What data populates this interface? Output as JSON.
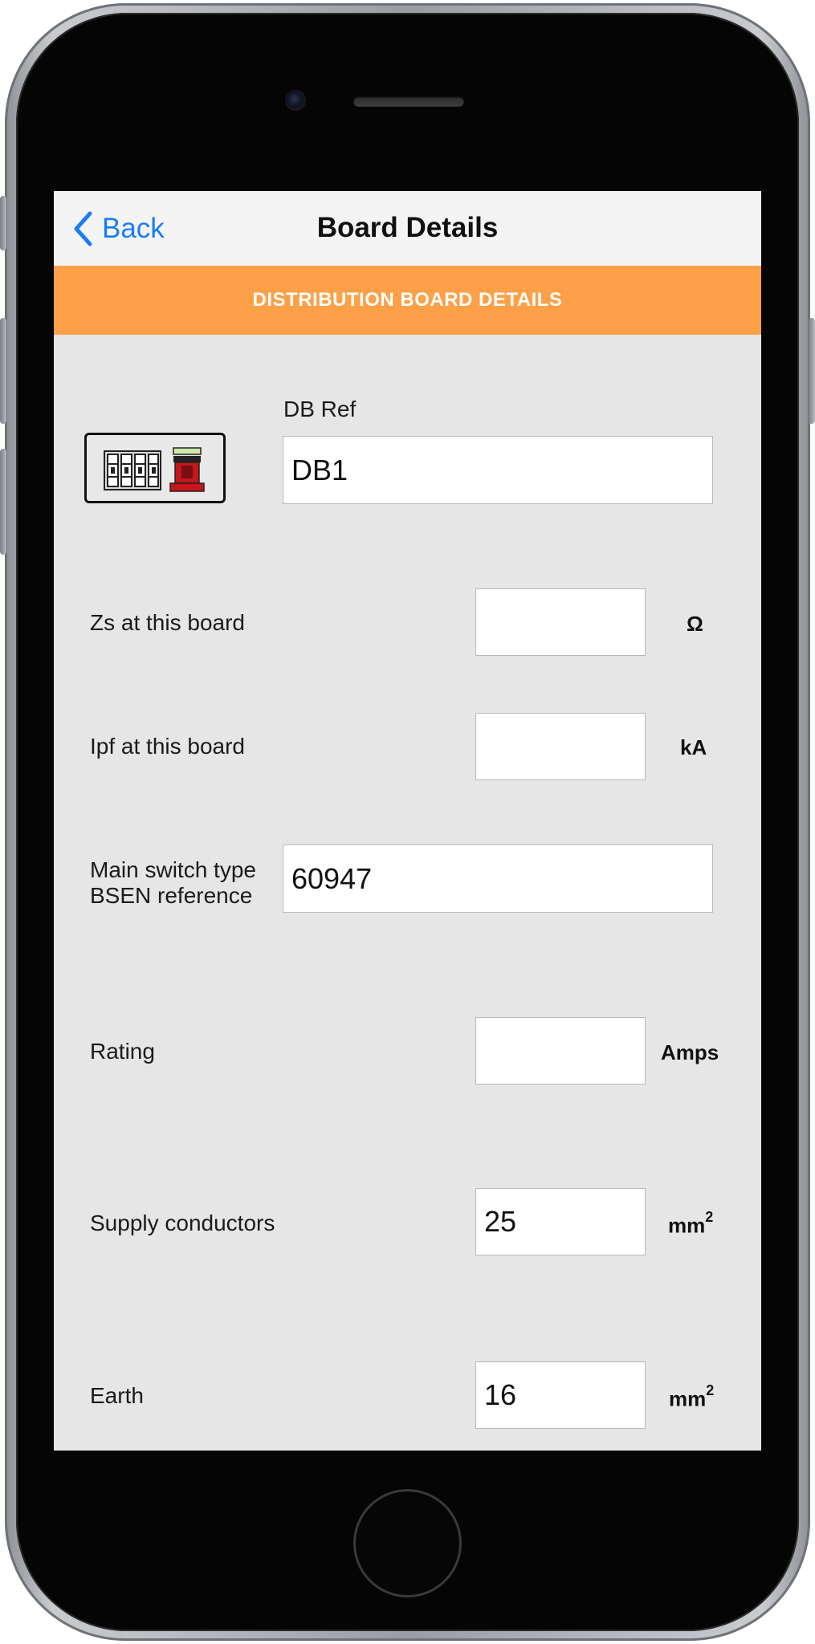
{
  "nav": {
    "back_label": "Back",
    "title": "Board Details"
  },
  "section": {
    "header": "DISTRIBUTION BOARD DETAILS"
  },
  "form": {
    "db_ref": {
      "label": "DB Ref",
      "value": "DB1"
    },
    "zs": {
      "label": "Zs at this board",
      "value": "",
      "unit": "Ω"
    },
    "ipf": {
      "label": "Ipf at this board",
      "value": "",
      "unit": "kA"
    },
    "main_switch": {
      "label_line1": "Main switch type",
      "label_line2": "BSEN reference",
      "value": "60947"
    },
    "rating": {
      "label": "Rating",
      "value": "",
      "unit": "Amps"
    },
    "supply_conductors": {
      "label": "Supply conductors",
      "value": "25",
      "unit": "mm",
      "unit_exp": "2"
    },
    "earth": {
      "label": "Earth",
      "value": "16",
      "unit": "mm",
      "unit_exp": "2"
    }
  },
  "colors": {
    "accent_orange": "#fda047",
    "ios_blue": "#1a7df7",
    "screen_bg": "#e6e6e6",
    "icon_red": "#c4161c"
  },
  "icons": {
    "back": "chevron-left-icon",
    "board": "distribution-board-icon"
  }
}
